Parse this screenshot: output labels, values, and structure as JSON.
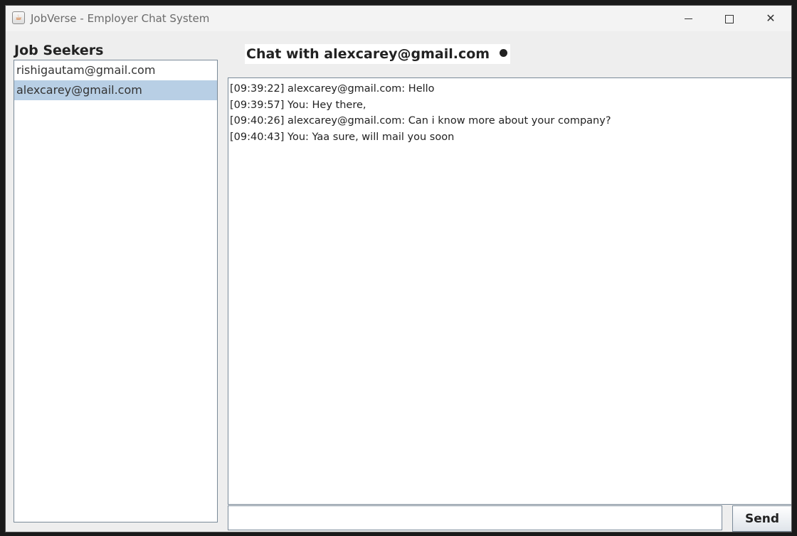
{
  "window": {
    "title": "JobVerse - Employer Chat System",
    "icon": "java-cup-icon"
  },
  "sidebar": {
    "heading": "Job Seekers",
    "items": [
      {
        "label": "rishigautam@gmail.com",
        "selected": false
      },
      {
        "label": "alexcarey@gmail.com",
        "selected": true
      }
    ]
  },
  "chat": {
    "header": "Chat with alexcarey@gmail.com",
    "status_icon": "status-dot-icon",
    "messages": [
      "[09:39:22] alexcarey@gmail.com: Hello",
      "[09:39:57] You: Hey there,",
      "[09:40:26] alexcarey@gmail.com: Can i know more about your company?",
      "[09:40:43] You: Yaa sure, will mail you soon"
    ],
    "input_value": "",
    "send_label": "Send"
  },
  "colors": {
    "selection": "#b8cfe5",
    "panel_bg": "#eeeeee",
    "border": "#7a8a99"
  }
}
